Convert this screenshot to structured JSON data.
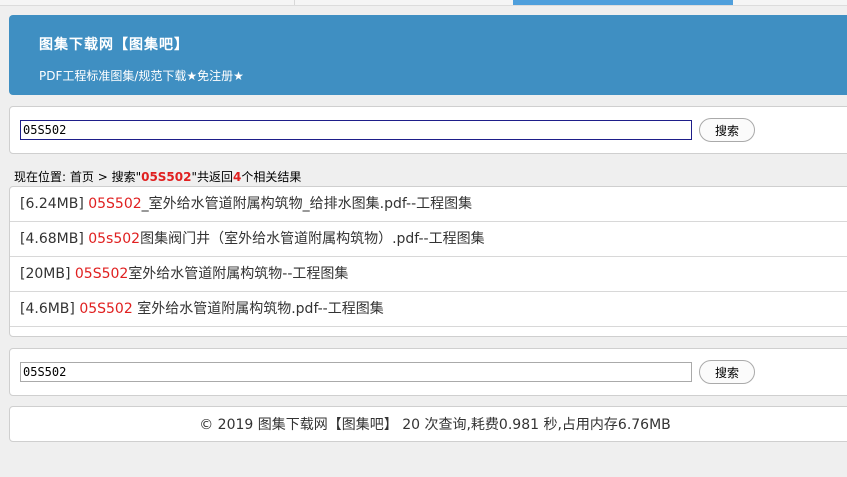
{
  "site": {
    "title": "图集下载网【图集吧】",
    "subtitle": "PDF工程标准图集/规范下载★免注册★"
  },
  "search_top": {
    "value": "05S502",
    "button": "搜索"
  },
  "breadcrumb": {
    "prefix": "现在位置: ",
    "home": "首页",
    "sep": " > ",
    "search_label": "搜索\"",
    "keyword": "05S502",
    "mid": "\"共返回",
    "count": "4",
    "suffix": "个相关结果"
  },
  "results": [
    {
      "size": "[6.24MB] ",
      "match": "05S502",
      "rest": "_室外给水管道附属构筑物_给排水图集.pdf--工程图集"
    },
    {
      "size": "[4.68MB] ",
      "match": "05s502",
      "rest": "图集阀门井（室外给水管道附属构筑物）.pdf--工程图集"
    },
    {
      "size": "[20MB] ",
      "match": "05S502",
      "rest": "室外给水管道附属构筑物--工程图集"
    },
    {
      "size": "[4.6MB] ",
      "match": "05S502",
      "rest": " 室外给水管道附属构筑物.pdf--工程图集"
    }
  ],
  "search_bottom": {
    "value": "05S502",
    "button": "搜索"
  },
  "footer": {
    "text": "© 2019  图集下载网【图集吧】  20 次查询,耗费0.981 秒,占用内存6.76MB"
  },
  "colors": {
    "header_bg": "#3f8fc2",
    "highlight": "#e02020",
    "page_bg": "#efefef"
  }
}
